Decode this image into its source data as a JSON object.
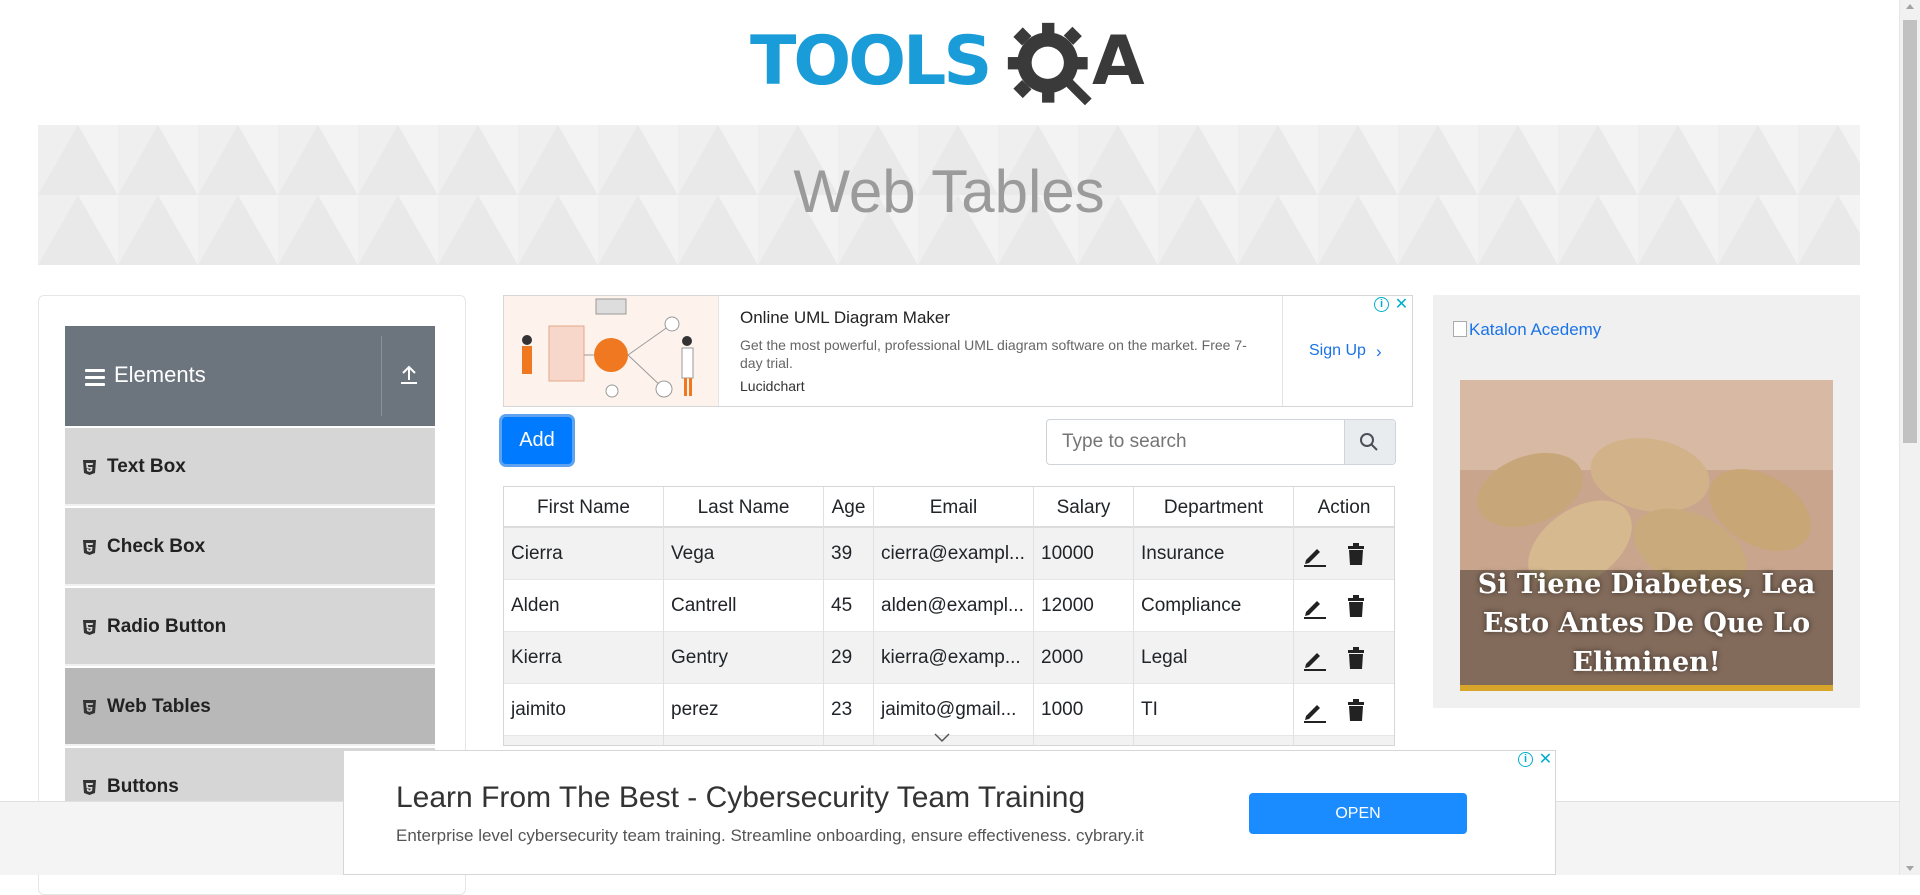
{
  "logo": {
    "part1": "TOOLS",
    "part2": "A"
  },
  "banner": {
    "title": "Web Tables"
  },
  "sidebar": {
    "group_title": "Elements",
    "items": [
      {
        "label": "Text Box"
      },
      {
        "label": "Check Box"
      },
      {
        "label": "Radio Button"
      },
      {
        "label": "Web Tables"
      },
      {
        "label": "Buttons"
      }
    ]
  },
  "ad_top": {
    "headline": "Online UML Diagram Maker",
    "description": "Get the most powerful, professional UML diagram software on the market. Free 7-day trial.",
    "brand": "Lucidchart",
    "cta": "Sign Up"
  },
  "toolbar": {
    "add_label": "Add",
    "search_placeholder": "Type to search"
  },
  "table": {
    "headers": [
      "First Name",
      "Last Name",
      "Age",
      "Email",
      "Salary",
      "Department",
      "Action"
    ],
    "rows": [
      [
        "Cierra",
        "Vega",
        "39",
        "cierra@exampl...",
        "10000",
        "Insurance"
      ],
      [
        "Alden",
        "Cantrell",
        "45",
        "alden@exampl...",
        "12000",
        "Compliance"
      ],
      [
        "Kierra",
        "Gentry",
        "29",
        "kierra@examp...",
        "2000",
        "Legal"
      ],
      [
        "jaimito",
        "perez",
        "23",
        "jaimito@gmail...",
        "1000",
        "TI"
      ]
    ]
  },
  "ad_right": {
    "alt_text": "Katalon Acedemy",
    "caption_line1": "Si Tiene Diabetes, Lea",
    "caption_line2": "Esto Antes De Que Lo",
    "caption_line3": "Eliminen!"
  },
  "ad_bottom": {
    "headline": "Learn From The Best - Cybersecurity Team Training",
    "description": "Enterprise level cybersecurity team training. Streamline onboarding, ensure effectiveness. cybrary.it",
    "cta": "OPEN"
  },
  "colors": {
    "brand_blue": "#1a9cd8",
    "header_gray": "#6c757d",
    "add_button": "#007bff"
  }
}
